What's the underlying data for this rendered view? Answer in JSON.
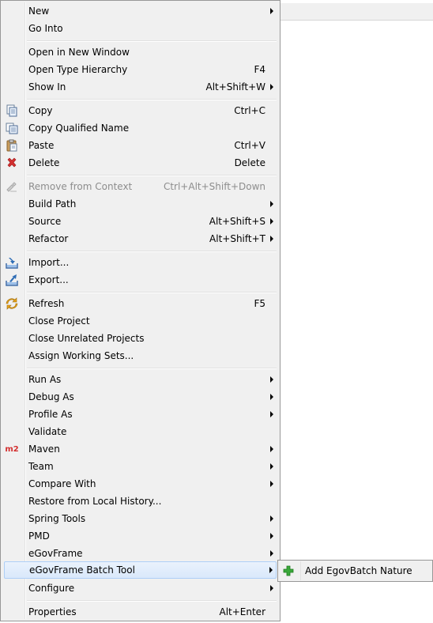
{
  "menu": {
    "items": [
      {
        "label": "New",
        "shortcut": "",
        "submenu": true
      },
      {
        "label": "Go Into",
        "shortcut": ""
      },
      {
        "label": "Open in New Window",
        "shortcut": ""
      },
      {
        "label": "Open Type Hierarchy",
        "shortcut": "F4"
      },
      {
        "label": "Show In",
        "shortcut": "Alt+Shift+W",
        "submenu": true
      },
      {
        "label": "Copy",
        "shortcut": "Ctrl+C",
        "icon": "copy-icon"
      },
      {
        "label": "Copy Qualified Name",
        "shortcut": "",
        "icon": "copy-qualified-name-icon"
      },
      {
        "label": "Paste",
        "shortcut": "Ctrl+V",
        "icon": "paste-icon"
      },
      {
        "label": "Delete",
        "shortcut": "Delete",
        "icon": "delete-icon"
      },
      {
        "label": "Remove from Context",
        "shortcut": "Ctrl+Alt+Shift+Down",
        "icon": "remove-from-context-icon",
        "disabled": true
      },
      {
        "label": "Build Path",
        "shortcut": "",
        "submenu": true
      },
      {
        "label": "Source",
        "shortcut": "Alt+Shift+S",
        "submenu": true
      },
      {
        "label": "Refactor",
        "shortcut": "Alt+Shift+T",
        "submenu": true
      },
      {
        "label": "Import...",
        "shortcut": "",
        "icon": "import-icon"
      },
      {
        "label": "Export...",
        "shortcut": "",
        "icon": "export-icon"
      },
      {
        "label": "Refresh",
        "shortcut": "F5",
        "icon": "refresh-icon"
      },
      {
        "label": "Close Project",
        "shortcut": ""
      },
      {
        "label": "Close Unrelated Projects",
        "shortcut": ""
      },
      {
        "label": "Assign Working Sets...",
        "shortcut": ""
      },
      {
        "label": "Run As",
        "shortcut": "",
        "submenu": true
      },
      {
        "label": "Debug As",
        "shortcut": "",
        "submenu": true
      },
      {
        "label": "Profile As",
        "shortcut": "",
        "submenu": true
      },
      {
        "label": "Validate",
        "shortcut": ""
      },
      {
        "label": "Maven",
        "shortcut": "",
        "submenu": true,
        "icon": "maven-m2-icon",
        "icon_text": "m2"
      },
      {
        "label": "Team",
        "shortcut": "",
        "submenu": true
      },
      {
        "label": "Compare With",
        "shortcut": "",
        "submenu": true
      },
      {
        "label": "Restore from Local History...",
        "shortcut": ""
      },
      {
        "label": "Spring Tools",
        "shortcut": "",
        "submenu": true
      },
      {
        "label": "PMD",
        "shortcut": "",
        "submenu": true
      },
      {
        "label": "eGovFrame",
        "shortcut": "",
        "submenu": true
      },
      {
        "label": "eGovFrame Batch Tool",
        "shortcut": "",
        "submenu": true,
        "highlighted": true
      },
      {
        "label": "Configure",
        "shortcut": "",
        "submenu": true
      },
      {
        "label": "Properties",
        "shortcut": "Alt+Enter"
      }
    ]
  },
  "submenu": {
    "items": [
      {
        "label": "Add EgovBatch Nature",
        "icon": "add-plus-icon"
      }
    ]
  },
  "colors": {
    "menu_bg": "#f0f0f0",
    "highlight": "#d9e8fb",
    "highlight_border": "#aecff7",
    "delete_icon": "#d32f2f",
    "maven_icon": "#d32f2f",
    "add_icon": "#3aa83a"
  }
}
